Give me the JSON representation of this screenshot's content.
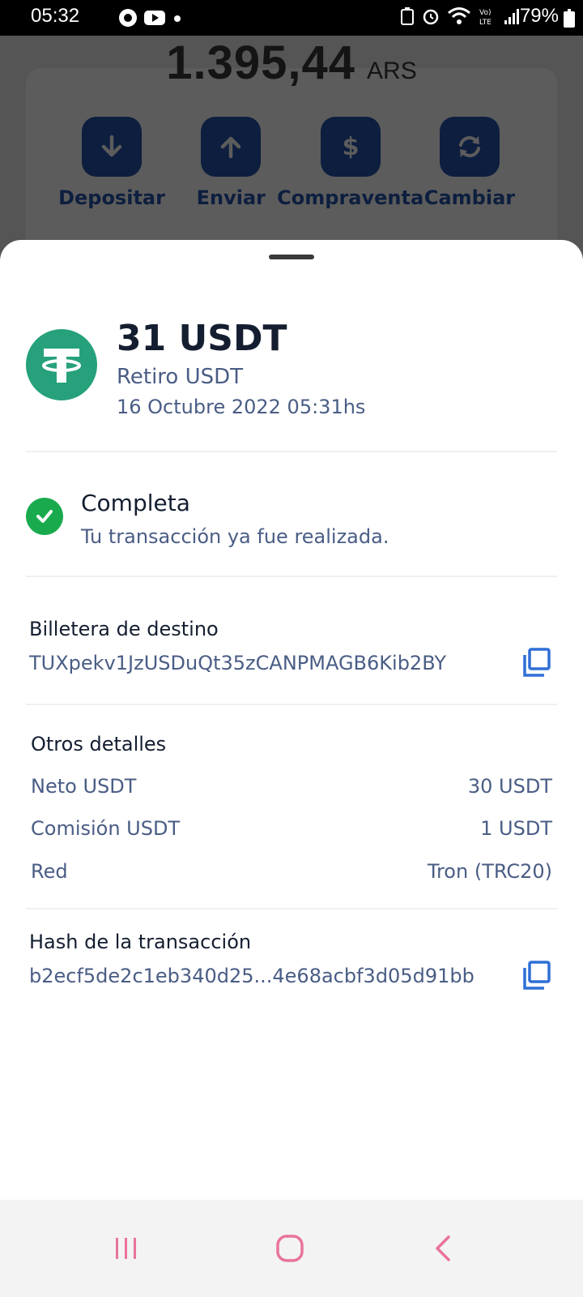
{
  "status_bar": {
    "time": "05:32",
    "battery": "79%"
  },
  "background": {
    "balance_amount": "1.395,44",
    "balance_currency": "ARS",
    "actions": [
      {
        "label": "Depositar",
        "icon": "arrow-down-icon"
      },
      {
        "label": "Enviar",
        "icon": "arrow-up-icon"
      },
      {
        "label": "Compraventa",
        "icon": "dollar-icon"
      },
      {
        "label": "Cambiar",
        "icon": "refresh-icon"
      }
    ]
  },
  "sheet": {
    "amount": "31 USDT",
    "type": "Retiro USDT",
    "date": "16 Octubre 2022 05:31hs",
    "status_title": "Completa",
    "status_subtitle": "Tu transacción ya fue realizada.",
    "wallet_label": "Billetera de destino",
    "wallet_value": "TUXpekv1JzUSDuQt35zCANPMAGB6Kib2BY",
    "details_label": "Otros detalles",
    "details": [
      {
        "key": "Neto USDT",
        "value": "30 USDT"
      },
      {
        "key": "Comisión USDT",
        "value": "1 USDT"
      },
      {
        "key": "Red",
        "value": "Tron (TRC20)"
      }
    ],
    "hash_label": "Hash de la transacción",
    "hash_value": "b2ecf5de2c1eb340d25...4e68acbf3d05d91bb"
  },
  "colors": {
    "accent": "#0d1e3f",
    "token_green": "#26a17b",
    "success_green": "#1aaa4e",
    "copy_blue": "#2f6fd6",
    "nav_pink": "#e8739b"
  }
}
